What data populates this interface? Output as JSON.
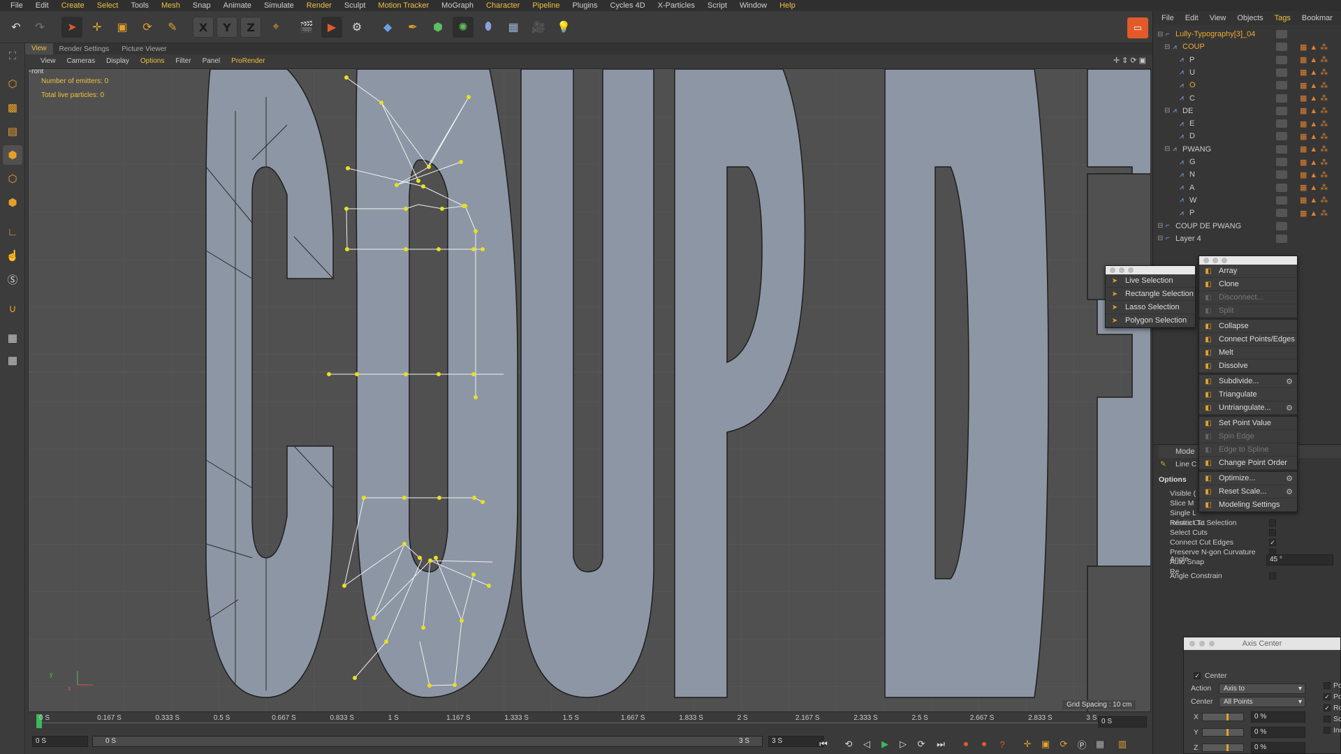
{
  "menubar": [
    "File",
    "Edit",
    "Create",
    "Select",
    "Tools",
    "Mesh",
    "Snap",
    "Animate",
    "Simulate",
    "Render",
    "Sculpt",
    "Motion Tracker",
    "MoGraph",
    "Character",
    "Pipeline",
    "Plugins",
    "Cycles 4D",
    "X-Particles",
    "Script",
    "Window",
    "Help"
  ],
  "menubar_highlight": [
    "Create",
    "Select",
    "Mesh",
    "Render",
    "Motion Tracker",
    "Character",
    "Pipeline",
    "Help"
  ],
  "toolbar": {
    "axis_x": "X",
    "axis_y": "Y",
    "axis_z": "Z"
  },
  "viewport_tabs": [
    "View",
    "Render Settings",
    "Picture Viewer"
  ],
  "viewport_menu": [
    "View",
    "Cameras",
    "Display",
    "Options",
    "Filter",
    "Panel",
    "ProRender"
  ],
  "viewport": {
    "camera": "Front",
    "emitters": "Number of emitters: 0",
    "particles": "Total live particles: 0",
    "grid_spacing": "Grid Spacing : 10 cm",
    "axis_y_label": "y",
    "axis_x_label": "x"
  },
  "timeline": {
    "ticks": [
      "0 S",
      "0.167 S",
      "0.333 S",
      "0.5 S",
      "0.667 S",
      "0.833 S",
      "1 S",
      "1.167 S",
      "1.333 S",
      "1.5 S",
      "1.667 S",
      "1.833 S",
      "2 S",
      "2.167 S",
      "2.333 S",
      "2.5 S",
      "2.667 S",
      "2.833 S",
      "3 S"
    ],
    "current_field": "0 S",
    "start_field": "0 S",
    "range_start": "0 S",
    "range_end": "3 S",
    "end_field": "3 S",
    "right_field": "0 S"
  },
  "object_manager": {
    "menu": [
      "File",
      "Edit",
      "View",
      "Objects",
      "Tags",
      "Bookmar"
    ],
    "menu_highlight": "Tags",
    "objects": [
      {
        "name": "Lully-Typography[3]_04",
        "level": 0,
        "selected": true
      },
      {
        "name": "COUP",
        "level": 1,
        "selected": true
      },
      {
        "name": "P",
        "level": 2,
        "selected": false
      },
      {
        "name": "U",
        "level": 2,
        "selected": false
      },
      {
        "name": "O",
        "level": 2,
        "selected": true
      },
      {
        "name": "C",
        "level": 2,
        "selected": false
      },
      {
        "name": "DE",
        "level": 1,
        "selected": false
      },
      {
        "name": "E",
        "level": 2,
        "selected": false
      },
      {
        "name": "D",
        "level": 2,
        "selected": false
      },
      {
        "name": "PWANG",
        "level": 1,
        "selected": false
      },
      {
        "name": "G",
        "level": 2,
        "selected": false
      },
      {
        "name": "N",
        "level": 2,
        "selected": false
      },
      {
        "name": "A",
        "level": 2,
        "selected": false
      },
      {
        "name": "W",
        "level": 2,
        "selected": false
      },
      {
        "name": "P",
        "level": 2,
        "selected": false
      },
      {
        "name": "COUP DE PWANG",
        "level": 0,
        "selected": false
      },
      {
        "name": "Layer 4",
        "level": 0,
        "selected": false
      }
    ]
  },
  "selection_palette": [
    "Live Selection",
    "Rectangle Selection",
    "Lasso Selection",
    "Polygon Selection"
  ],
  "mesh_palette": [
    {
      "label": "Array",
      "enabled": true,
      "gear": false
    },
    {
      "label": "Clone",
      "enabled": true,
      "gear": false
    },
    {
      "label": "Disconnect...",
      "enabled": false,
      "gear": false
    },
    {
      "label": "Split",
      "enabled": false,
      "gear": false
    },
    {
      "sep": true
    },
    {
      "label": "Collapse",
      "enabled": true,
      "gear": false
    },
    {
      "label": "Connect Points/Edges",
      "enabled": true,
      "gear": false
    },
    {
      "label": "Melt",
      "enabled": true,
      "gear": false
    },
    {
      "label": "Dissolve",
      "enabled": true,
      "gear": false
    },
    {
      "sep": true
    },
    {
      "label": "Subdivide...",
      "enabled": true,
      "gear": true
    },
    {
      "label": "Triangulate",
      "enabled": true,
      "gear": false
    },
    {
      "label": "Untriangulate...",
      "enabled": true,
      "gear": true
    },
    {
      "sep": true
    },
    {
      "label": "Set Point Value",
      "enabled": true,
      "gear": false
    },
    {
      "label": "Spin Edge",
      "enabled": false,
      "gear": false
    },
    {
      "label": "Edge to Spline",
      "enabled": false,
      "gear": false
    },
    {
      "label": "Change Point Order",
      "enabled": true,
      "gear": false
    },
    {
      "sep": true
    },
    {
      "label": "Optimize...",
      "enabled": true,
      "gear": true
    },
    {
      "label": "Reset Scale...",
      "enabled": true,
      "gear": true
    },
    {
      "label": "Modeling Settings",
      "enabled": true,
      "gear": false
    }
  ],
  "attributes": {
    "mode": "Mode",
    "tool": "Line C",
    "options_header": "Options",
    "partial_rows": [
      "Visible (",
      "Slice M",
      "Single L",
      "Infinite Cut"
    ],
    "rows": [
      {
        "label": "Restrict To Selection",
        "checked": false
      },
      {
        "label": "Select Cuts",
        "checked": false
      },
      {
        "label": "Connect Cut Edges",
        "checked": true
      },
      {
        "label": "Preserve N-gon Curvature",
        "checked": false
      },
      {
        "label": "Auto Snap",
        "checked": true
      },
      {
        "label": "Angle Constrain",
        "checked": false
      }
    ],
    "angle_label": "Angle",
    "angle_value": "45 °",
    "re_label": "Re"
  },
  "axis_center": {
    "title": "Axis Center",
    "center_checkbox": "Center",
    "action_label": "Action",
    "action_value": "Axis to",
    "center_label": "Center",
    "center_value": "All Points",
    "x_label": "X",
    "y_label": "Y",
    "z_label": "Z",
    "x_value": "0 %",
    "y_value": "0 %",
    "z_value": "0 %",
    "right_labels": [
      "Poi",
      "Pol",
      "Rot",
      "Sca",
      "Inc"
    ]
  },
  "colors": {
    "accent": "#f0c040",
    "selected_text": "#f0a830",
    "letter_fill": "#8d96a4",
    "viewport_bg": "#505050",
    "point": "#e8e020"
  },
  "icons": [
    "undo-icon",
    "redo-icon",
    "select-arrow-icon",
    "move-icon",
    "scale-icon",
    "rotate-icon",
    "pen-icon",
    "render-icon",
    "cube-icon",
    "light-icon"
  ]
}
